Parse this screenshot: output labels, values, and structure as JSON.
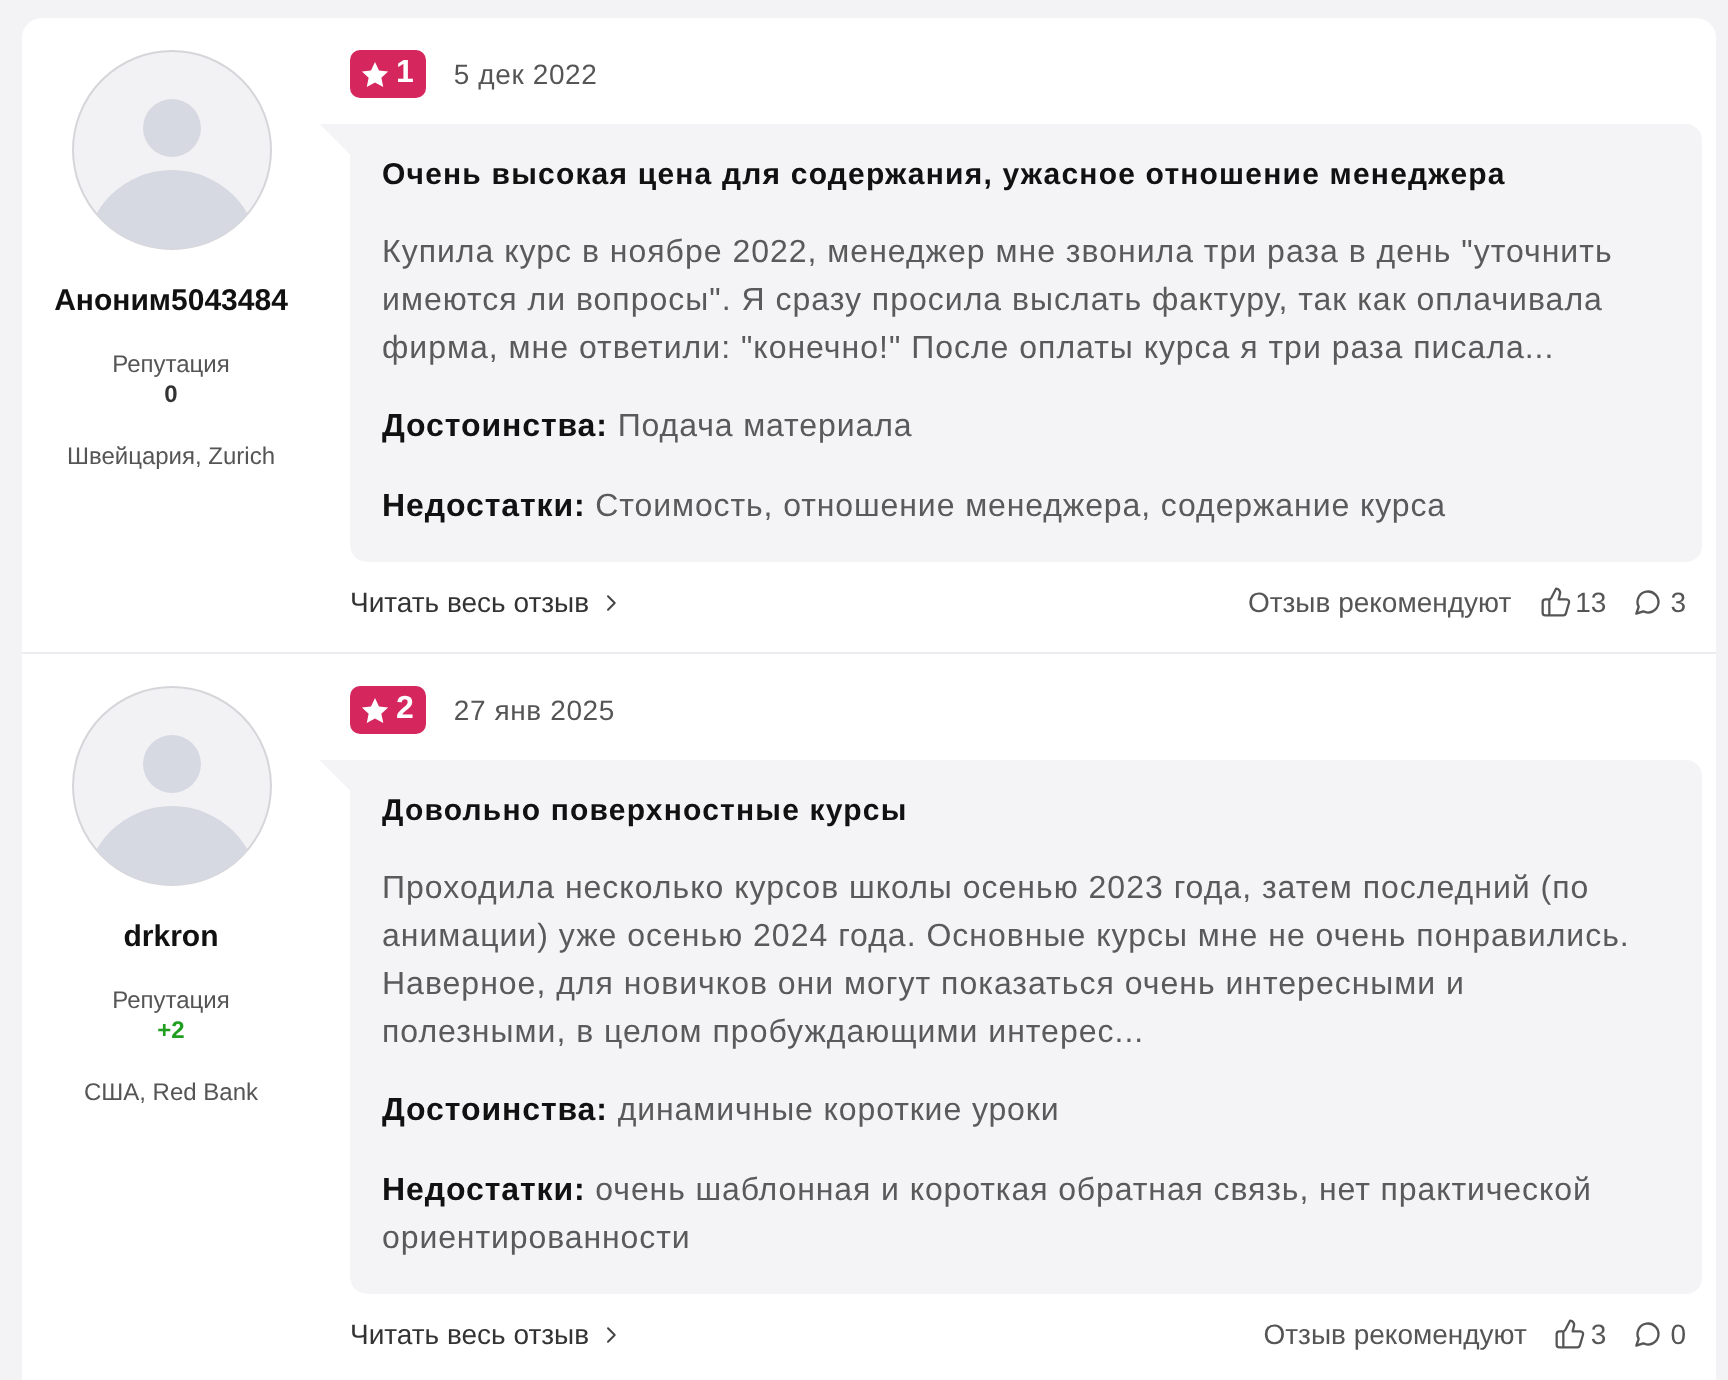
{
  "reviews": [
    {
      "author": {
        "name": "Аноним5043484",
        "reputation_label": "Репутация",
        "reputation": {
          "value": "0",
          "color": "#333333"
        },
        "location": "Швейцария, Zurich"
      },
      "rating": "1",
      "date": "5 дек 2022",
      "title": "Очень высокая цена для содержания, ужасное отношение менеджера",
      "text": "Купила курс в ноябре 2022, менеджер мне звонила три раза в день \"уточнить имеются ли вопросы\". Я сразу просила выслать фактуру, так как оплачивала фирма, мне ответили: \"конечно!\" После оплаты курса я три раза писала...",
      "pros": "**Достоинства:** Подача материала",
      "cons": "**Недостатки:** Стоимость, отношение менеджера, содержание курса",
      "read_more": "Читать весь отзыв",
      "recommend_label": "Отзыв рекомендуют",
      "likes": "13",
      "comments": "3"
    },
    {
      "author": {
        "name": "drkron",
        "reputation_label": "Репутация",
        "reputation": {
          "value": "+2",
          "color": "#1f9e1f"
        },
        "location": "США, Red Bank"
      },
      "rating": "2",
      "date": "27 янв 2025",
      "title": "Довольно поверхностные курсы",
      "text": "Проходила несколько курсов школы осенью 2023 года, затем последний (по анимации) уже осенью 2024 года. Основные курсы мне не очень понравились. Наверное, для новичков они могут показаться очень интересными и полезными, в целом пробуждающими интерес...",
      "pros": "**Достоинства:** динамичные короткие уроки",
      "cons": "**Недостатки:** очень шаблонная и короткая обратная связь, нет практической ориентированности",
      "read_more": "Читать весь отзыв",
      "recommend_label": "Отзыв рекомендуют",
      "likes": "3",
      "comments": "0"
    }
  ]
}
